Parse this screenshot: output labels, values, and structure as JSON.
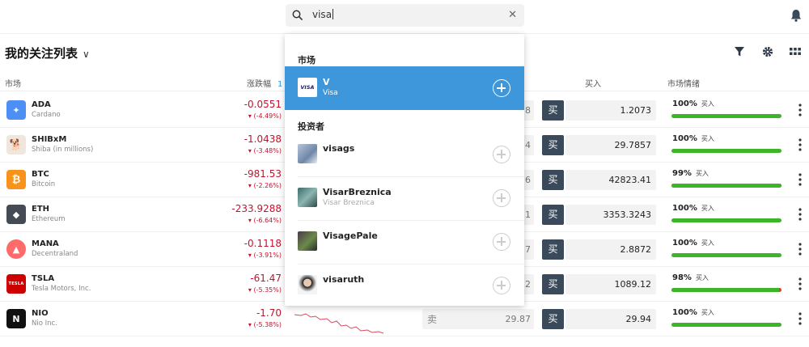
{
  "search": {
    "query": "visa",
    "clear_icon": "close-icon"
  },
  "header": {
    "title": "我的关注列表",
    "chevron": "∨"
  },
  "columns": {
    "market": "市场",
    "change": "涨跌幅",
    "change_extra": "1",
    "buy": "买入",
    "sentiment": "市场情绪"
  },
  "labels": {
    "sell": "卖",
    "buy": "买",
    "buy_small": "买入"
  },
  "rows": [
    {
      "symbol": "ADA",
      "name": "Cardano",
      "change": "-0.0551",
      "change_pct": "▾ (-4.49%)",
      "sell_tail": "8",
      "buy": "1.2073",
      "sentiment": "100%",
      "sent_fraction": 1.0,
      "logo_color": "#4d8ff5",
      "logo_text": "✦"
    },
    {
      "symbol": "SHIBxM",
      "name": "Shiba (in millions)",
      "change": "-1.0438",
      "change_pct": "▾ (-3.48%)",
      "sell_tail": "4",
      "buy": "29.7857",
      "sentiment": "100%",
      "sent_fraction": 1.0,
      "logo_color": "#f0e6de",
      "logo_text": "🐕"
    },
    {
      "symbol": "BTC",
      "name": "Bitcoin",
      "change": "-981.53",
      "change_pct": "▾ (-2.26%)",
      "sell_tail": "6",
      "buy": "42823.41",
      "sentiment": "99%",
      "sent_fraction": 0.99,
      "logo_color": "#f7931a",
      "logo_text": "₿"
    },
    {
      "symbol": "ETH",
      "name": "Ethereum",
      "change": "-233.9288",
      "change_pct": "▾ (-6.64%)",
      "sell_tail": "1",
      "buy": "3353.3243",
      "sentiment": "100%",
      "sent_fraction": 1.0,
      "logo_color": "#444b55",
      "logo_text": "◆"
    },
    {
      "symbol": "MANA",
      "name": "Decentraland",
      "change": "-0.1118",
      "change_pct": "▾ (-3.91%)",
      "sell_tail": "7",
      "buy": "2.8872",
      "sentiment": "100%",
      "sent_fraction": 1.0,
      "logo_color": "#ff4d4d",
      "logo_text": "▲"
    },
    {
      "symbol": "TSLA",
      "name": "Tesla Motors, Inc.",
      "change": "-61.47",
      "change_pct": "▾ (-5.35%)",
      "sell_tail": "2",
      "buy": "1089.12",
      "sentiment": "98%",
      "sent_fraction": 0.98,
      "logo_color": "#cc0000",
      "logo_text": "TESLA"
    },
    {
      "symbol": "NIO",
      "name": "Nio Inc.",
      "change": "-1.70",
      "change_pct": "▾ (-5.38%)",
      "sell_tail": "29.87",
      "buy": "29.94",
      "sentiment": "100%",
      "sent_fraction": 1.0,
      "logo_color": "#111111",
      "logo_text": "N"
    }
  ],
  "dropdown": {
    "markets_heading": "市场",
    "market_item": {
      "title": "V",
      "subtitle": "Visa",
      "logo_text": "VISA"
    },
    "investors_heading": "投资者",
    "investors": [
      {
        "title": "visags",
        "subtitle": ""
      },
      {
        "title": "VisarBreznica",
        "subtitle": "Visar Breznica"
      },
      {
        "title": "VisagePale",
        "subtitle": ""
      },
      {
        "title": "visaruth",
        "subtitle": ""
      }
    ]
  }
}
